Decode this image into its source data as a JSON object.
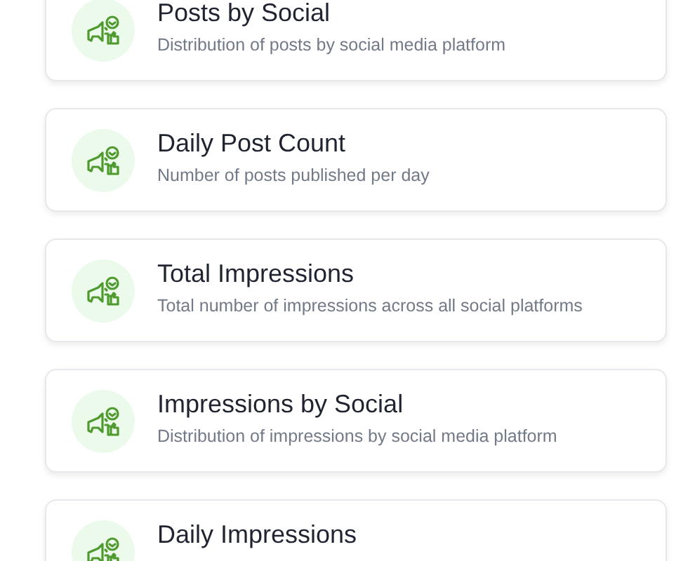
{
  "cards": [
    {
      "title": "Posts by Social",
      "description": "Distribution of posts by social media platform"
    },
    {
      "title": "Daily Post Count",
      "description": "Number of posts published per day"
    },
    {
      "title": "Total Impressions",
      "description": "Total number of impressions across all social platforms"
    },
    {
      "title": "Impressions by Social",
      "description": "Distribution of impressions by social media platform"
    },
    {
      "title": "Daily Impressions"
    }
  ]
}
